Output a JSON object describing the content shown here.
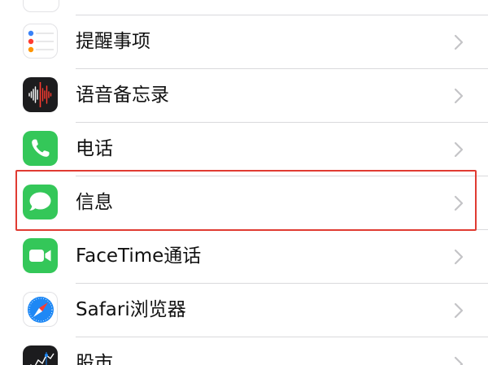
{
  "settings_list": {
    "items": [
      {
        "label": "提醒事项",
        "icon": "reminders-icon"
      },
      {
        "label": "语音备忘录",
        "icon": "voice-memos-icon"
      },
      {
        "label": "电话",
        "icon": "phone-icon"
      },
      {
        "label": "信息",
        "icon": "messages-icon"
      },
      {
        "label": "FaceTime通话",
        "icon": "facetime-icon"
      },
      {
        "label": "Safari浏览器",
        "icon": "safari-icon"
      },
      {
        "label": "股市",
        "icon": "stocks-icon"
      }
    ],
    "highlighted_item": "信息"
  },
  "colors": {
    "highlight_border": "#e03b32",
    "phone_green": "#34c759",
    "messages_green": "#34c759",
    "facetime_green": "#34c759",
    "voice_memos_bg": "#1c1c1e",
    "safari_blue": "#1e88f5",
    "stocks_bg": "#1c1c1e",
    "chevron": "#c4c4c7",
    "separator": "#d9d9dc"
  }
}
